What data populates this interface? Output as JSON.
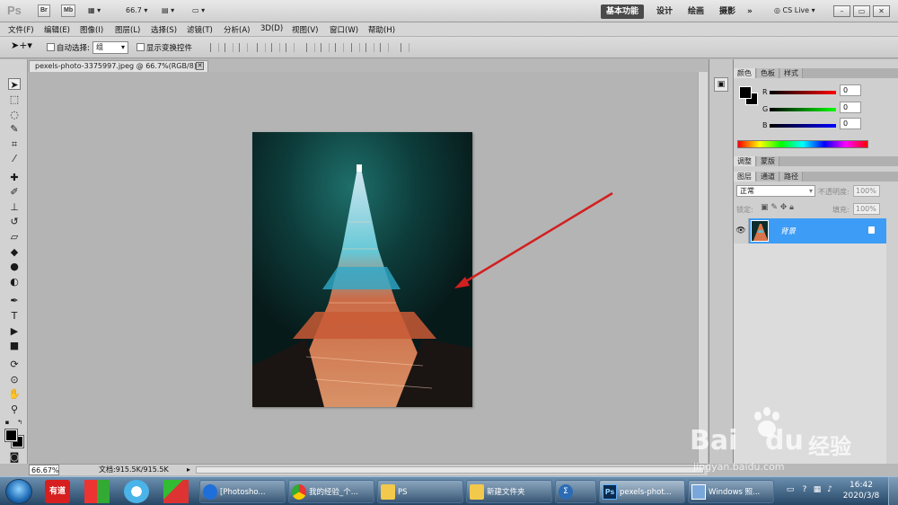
{
  "appbar": {
    "logo": "Ps",
    "bridge": "Br",
    "minibridge": "Mb",
    "zoom": "66.7",
    "workspaces": [
      "基本功能",
      "设计",
      "绘画",
      "摄影"
    ],
    "more": "»",
    "cslive": "CS Live",
    "controls": [
      "–",
      "▭",
      "✕"
    ]
  },
  "menu": [
    "文件(F)",
    "编辑(E)",
    "图像(I)",
    "图层(L)",
    "选择(S)",
    "滤镜(T)",
    "分析(A)",
    "3D(D)",
    "视图(V)",
    "窗口(W)",
    "帮助(H)"
  ],
  "options": {
    "auto_select_label": "自动选择:",
    "auto_select_value": "组",
    "show_transform_label": "显示变换控件"
  },
  "document": {
    "tab_title": "pexels-photo-3375997.jpeg @ 66.7%(RGB/8)",
    "zoom": "66.67%",
    "doc_size": "文档:915.5K/915.5K"
  },
  "color_panel": {
    "tabs": [
      "颜色",
      "色板",
      "样式"
    ],
    "channels": [
      {
        "label": "R",
        "value": "0"
      },
      {
        "label": "G",
        "value": "0"
      },
      {
        "label": "B",
        "value": "0"
      }
    ]
  },
  "adjust_panel": {
    "tabs": [
      "调整",
      "蒙版"
    ]
  },
  "layers_panel": {
    "tabs": [
      "图层",
      "通道",
      "路径"
    ],
    "blend_mode": "正常",
    "opacity_label": "不透明度:",
    "opacity": "100%",
    "lock_label": "锁定:",
    "fill_label": "填充:",
    "fill": "100%",
    "layer_name": "背景"
  },
  "taskbar": {
    "tasks": [
      "[Photosho...",
      "我的经验_个...",
      "PS",
      "新建文件夹",
      "",
      "pexels-phot...",
      "Windows 照..."
    ],
    "time": "16:42",
    "date": "2020/3/8",
    "apps": [
      "有道",
      "Office",
      "Flower",
      "Media"
    ]
  },
  "watermark": {
    "brand": "Bai",
    "brand2": "du",
    "text": "经验",
    "url": "jingyan.baidu.com"
  },
  "colors": {
    "accent": "#3d9cf5",
    "arrow": "#d22020",
    "photo_bg": "#0b2c2b"
  }
}
